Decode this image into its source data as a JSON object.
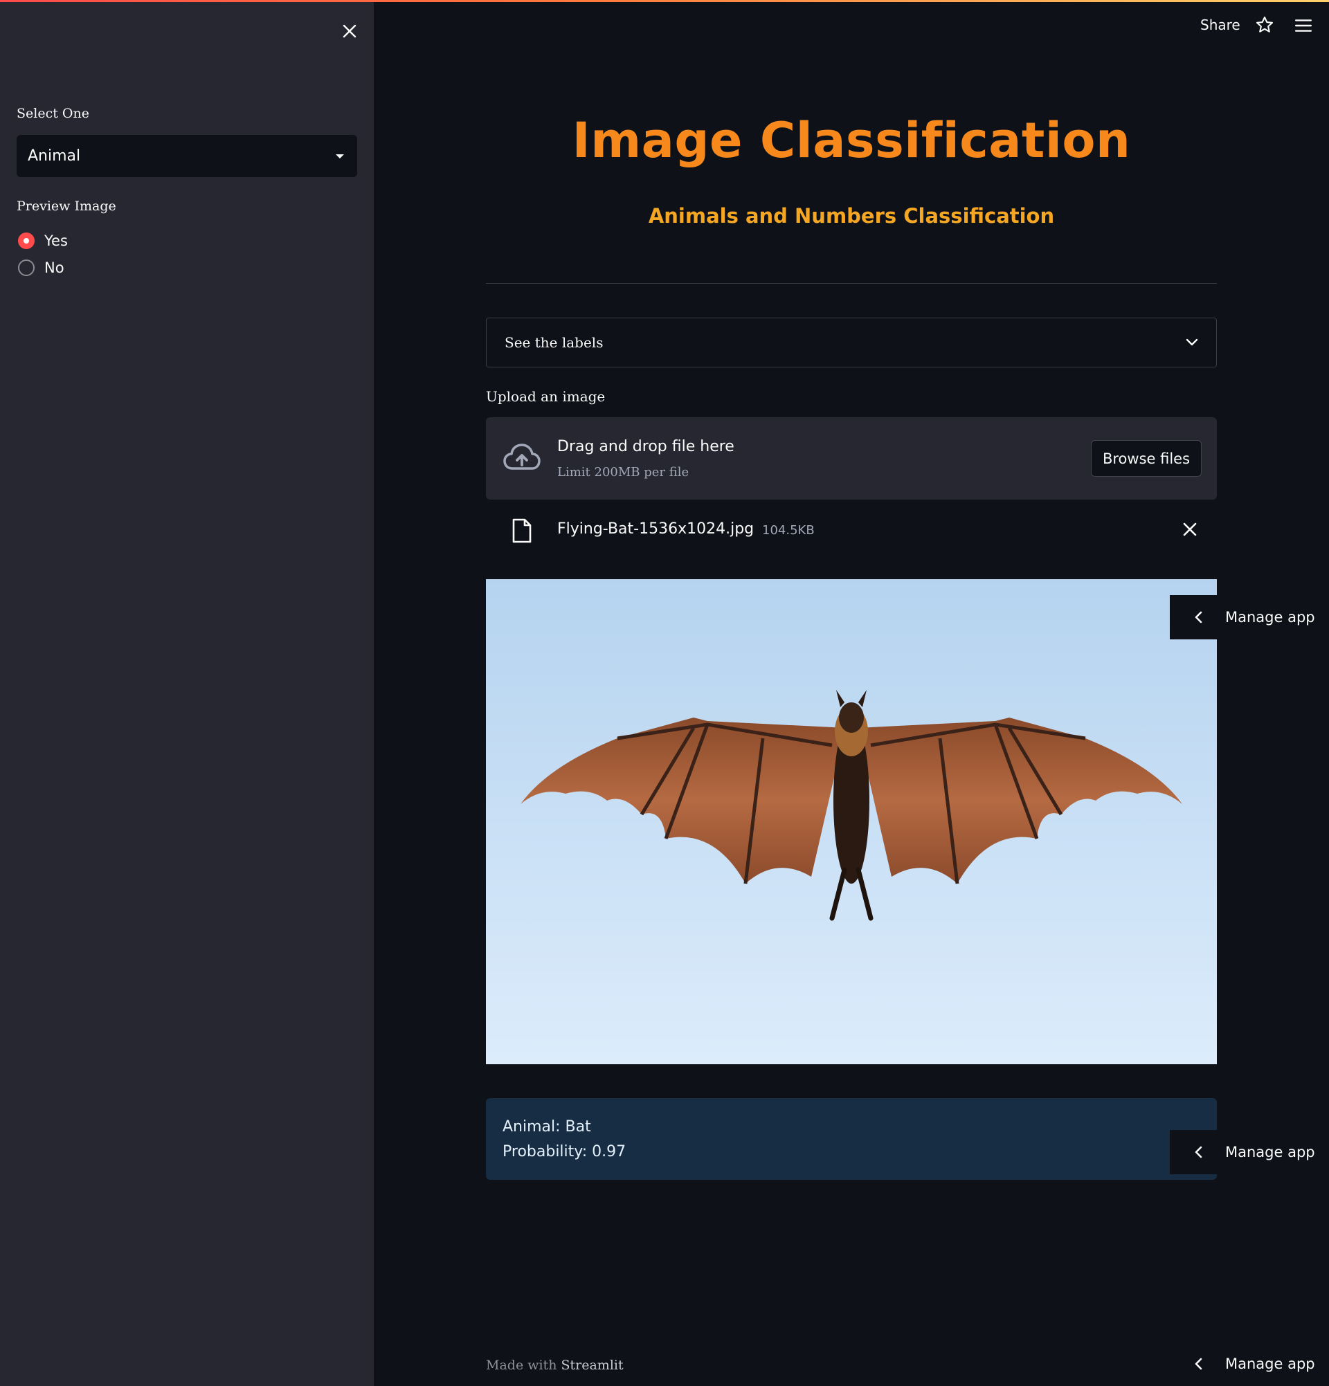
{
  "sidebar": {
    "select_label": "Select One",
    "select_value": "Animal",
    "preview_label": "Preview Image",
    "radio_options": [
      "Yes",
      "No"
    ],
    "radio_selected": "Yes"
  },
  "header": {
    "share": "Share"
  },
  "main": {
    "title": "Image Classification",
    "subtitle": "Animals and Numbers Classification",
    "expander_label": "See the labels",
    "upload_label": "Upload an image",
    "dropzone_title": "Drag and drop file here",
    "dropzone_limit": "Limit 200MB per file",
    "browse_button": "Browse files",
    "file_name": "Flying-Bat-1536x1024.jpg",
    "file_size": "104.5KB",
    "result_line1": "Animal: Bat",
    "result_line2": "Probability: 0.97"
  },
  "manage_app": "Manage app",
  "footer": {
    "prefix": "Made with",
    "brand": "Streamlit"
  },
  "colors": {
    "accent": "#ff4b4b",
    "title": "#f7891c",
    "subtitle": "#f5a623",
    "background": "#0e1117",
    "sidebar": "#262730",
    "result_bg": "#172d43"
  },
  "icons": [
    "close-icon",
    "chevron-down-icon",
    "star-icon",
    "menu-icon",
    "cloud-upload-icon",
    "file-icon",
    "chevron-left-icon"
  ]
}
